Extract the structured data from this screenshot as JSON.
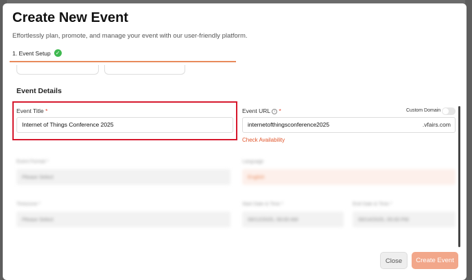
{
  "modal": {
    "title": "Create New Event",
    "subtitle": "Effortlessly plan, promote, and manage your event with our user-friendly platform."
  },
  "steps": [
    {
      "label": "1. Event Setup",
      "completed": true
    }
  ],
  "section": {
    "title": "Event Details"
  },
  "event_title": {
    "label": "Event Title",
    "required_mark": "*",
    "value": "Internet of Things Conference 2025"
  },
  "event_url": {
    "label": "Event URL",
    "required_mark": "*",
    "info_icon": "info-icon",
    "value": "internetofthingsconference2025",
    "suffix": ".vfairs.com",
    "check_link": "Check Availability"
  },
  "custom_domain": {
    "label": "Custom Domain",
    "enabled": false
  },
  "blurred": {
    "event_format_label": "Event Format *",
    "event_format_value": "Please Select",
    "language_label": "Language",
    "language_value": "English",
    "timezone_label": "Timezone *",
    "timezone_value": "Please Select",
    "start_label": "Start Date & Time *",
    "start_value": "09/12/2025, 09:00 AM",
    "end_label": "End Date & Time *",
    "end_value": "09/14/2025, 05:00 PM"
  },
  "footer": {
    "close_label": "Close",
    "create_label": "Create Event"
  },
  "colors": {
    "accent": "#e8895a",
    "highlight": "#d6172c",
    "success": "#3fb950"
  }
}
